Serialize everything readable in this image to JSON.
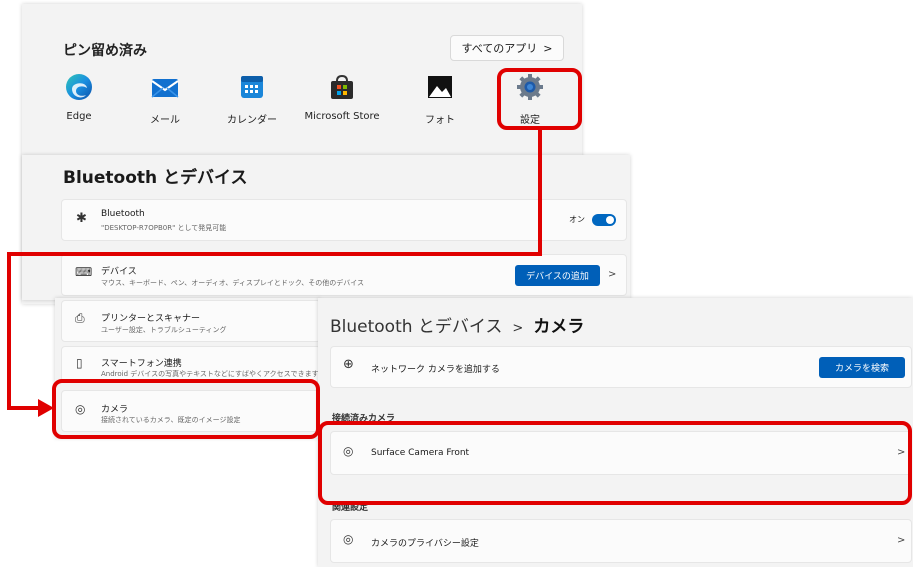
{
  "start_menu": {
    "pinned_title": "ピン留め済み",
    "all_apps_label": "すべてのアプリ",
    "all_apps_chevron": ">",
    "apps": [
      {
        "label": "Edge",
        "icon": "edge-icon"
      },
      {
        "label": "メール",
        "icon": "mail-icon"
      },
      {
        "label": "カレンダー",
        "icon": "calendar-icon"
      },
      {
        "label": "Microsoft Store",
        "icon": "store-icon"
      },
      {
        "label": "フォト",
        "icon": "photos-icon"
      },
      {
        "label": "設定",
        "icon": "gear-icon"
      }
    ]
  },
  "settings": {
    "title": "Bluetooth とデバイス",
    "bluetooth": {
      "title": "Bluetooth",
      "sub": "\"DESKTOP-R7OPB0R\" として発見可能",
      "toggle_label": "オン"
    },
    "devices": {
      "title": "デバイス",
      "sub": "マウス、キーボード、ペン、オーディオ、ディスプレイとドック、その他のデバイス",
      "button": "デバイスの追加",
      "chevron": ">"
    },
    "printers": {
      "title": "プリンターとスキャナー",
      "sub": "ユーザー設定、トラブルシューティング"
    },
    "phone": {
      "title": "スマートフォン連携",
      "sub": "Android デバイスの写真やテキストなどにすばやくアクセスできます"
    },
    "camera": {
      "title": "カメラ",
      "sub": "接続されているカメラ、既定のイメージ設定"
    }
  },
  "camera_page": {
    "breadcrumb_parent": "Bluetooth とデバイス",
    "breadcrumb_sep": ">",
    "breadcrumb_current": "カメラ",
    "network_camera_label": "ネットワーク カメラを追加する",
    "search_button": "カメラを検索",
    "connected_section": "接続済みカメラ",
    "connected_camera": "Surface Camera Front",
    "related_section": "関連設定",
    "privacy_label": "カメラのプライバシー設定",
    "chevron": ">"
  },
  "colors": {
    "accent": "#005fb8",
    "annotation": "#e00000"
  }
}
